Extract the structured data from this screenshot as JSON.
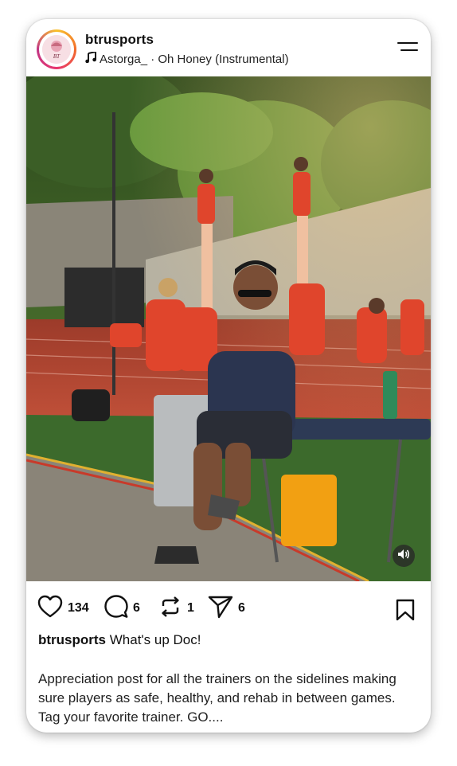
{
  "post": {
    "username": "btrusports",
    "audio": "Astorga_ · Oh Honey (Instrumental)",
    "avatar_text": "BT",
    "likes": "134",
    "comments": "6",
    "reposts": "1",
    "shares": "6",
    "caption_user": "btrusports",
    "caption_title": "What's up Doc!",
    "caption_body": "Appreciation post for all the trainers on the sidelines making sure players as safe, healthy, and rehab in between games. Tag your favorite trainer. GO...."
  },
  "icons": {
    "music": "music-note-icon",
    "menu": "hamburger-menu-icon",
    "like": "heart-icon",
    "comment": "comment-bubble-icon",
    "repost": "repost-icon",
    "share": "send-icon",
    "save": "bookmark-icon",
    "sound": "speaker-icon"
  },
  "colors": {
    "uniform": "#e0452c",
    "track": "#b8442e",
    "turf": "#3c6a2c",
    "avatar_ring": "#e8366f"
  }
}
